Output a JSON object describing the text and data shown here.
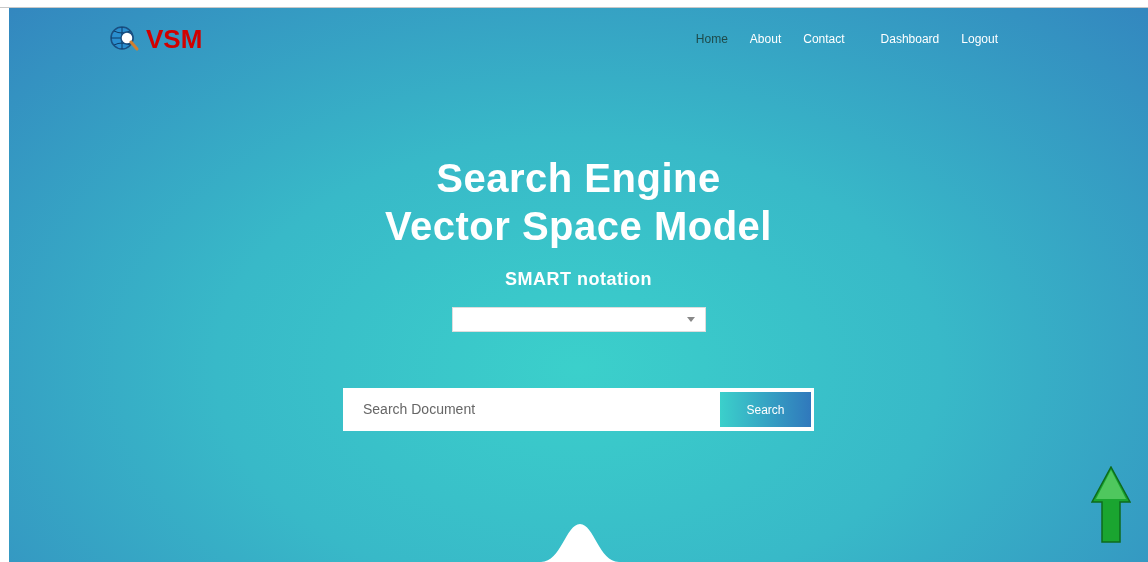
{
  "logo": {
    "text": "VSM"
  },
  "nav": [
    {
      "label": "Home",
      "selected": true
    },
    {
      "label": "About",
      "selected": false
    },
    {
      "label": "Contact",
      "selected": false
    },
    {
      "label": "Dashboard",
      "selected": false
    },
    {
      "label": "Logout",
      "selected": false
    }
  ],
  "hero": {
    "title_lines": [
      "Search Engine",
      "Vector Space Model"
    ],
    "subtitle": "SMART notation"
  },
  "search": {
    "placeholder": "Search Document",
    "button": "Search"
  }
}
